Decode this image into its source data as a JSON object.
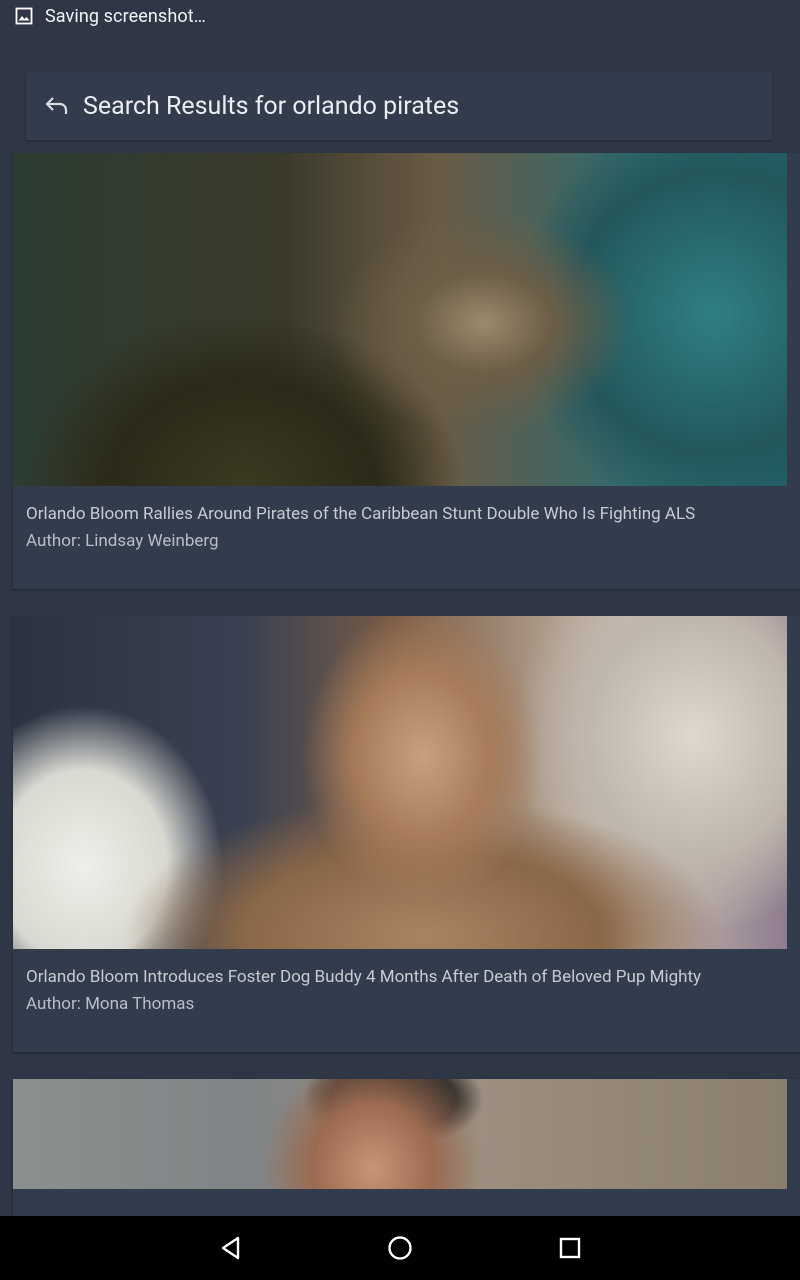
{
  "status_bar": {
    "notification_text": "Saving screenshot…",
    "icon": "image-icon"
  },
  "header": {
    "title": "Search Results for orlando pirates",
    "back_icon": "undo-arrow-icon"
  },
  "results": [
    {
      "title": "Orlando Bloom Rallies Around Pirates of the Caribbean Stunt Double Who Is Fighting ALS",
      "author": "Author: Lindsay Weinberg"
    },
    {
      "title": "Orlando Bloom Introduces Foster Dog Buddy 4 Months After Death of Beloved Pup Mighty",
      "author": "Author: Mona Thomas"
    },
    {
      "title": "",
      "author": ""
    }
  ],
  "nav_bar": {
    "back": "back-triangle-icon",
    "home": "home-circle-icon",
    "recents": "recents-square-icon"
  },
  "colors": {
    "background": "#2f3747",
    "card": "#333c4c",
    "title_text": "#c7cbd3",
    "header_text": "#eceef2",
    "nav_bar": "#000000"
  }
}
